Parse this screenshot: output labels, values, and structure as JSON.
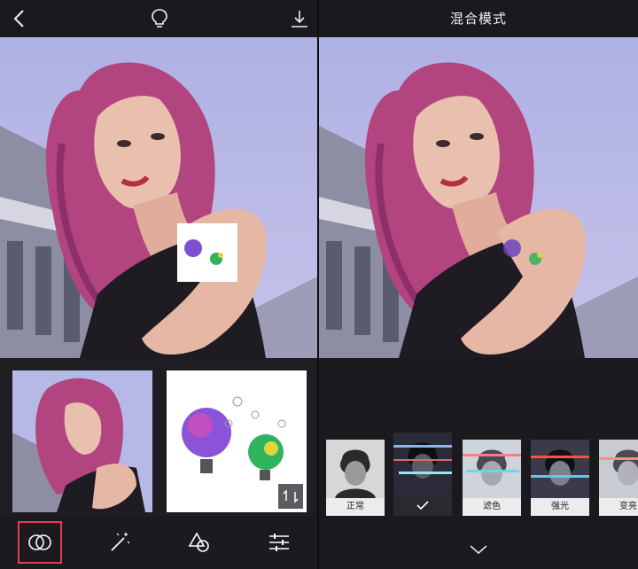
{
  "left_panel": {
    "tools": [
      {
        "icon": "blend-circles-icon",
        "active": true
      },
      {
        "icon": "magic-wand-icon",
        "active": false
      },
      {
        "icon": "shapes-icon",
        "active": false
      },
      {
        "icon": "sliders-icon",
        "active": false
      }
    ]
  },
  "right_panel": {
    "title": "混合模式",
    "blend_modes": [
      {
        "label": "正常",
        "selected": false
      },
      {
        "label": "",
        "selected": true
      },
      {
        "label": "滤色",
        "selected": false
      },
      {
        "label": "强光",
        "selected": false
      },
      {
        "label": "变亮",
        "selected": false
      }
    ]
  },
  "colors": {
    "accent_red": "#e0404d",
    "toolbar_bg": "#1a191d",
    "hair": "#b2447f",
    "sky": "#b8bbe6"
  }
}
